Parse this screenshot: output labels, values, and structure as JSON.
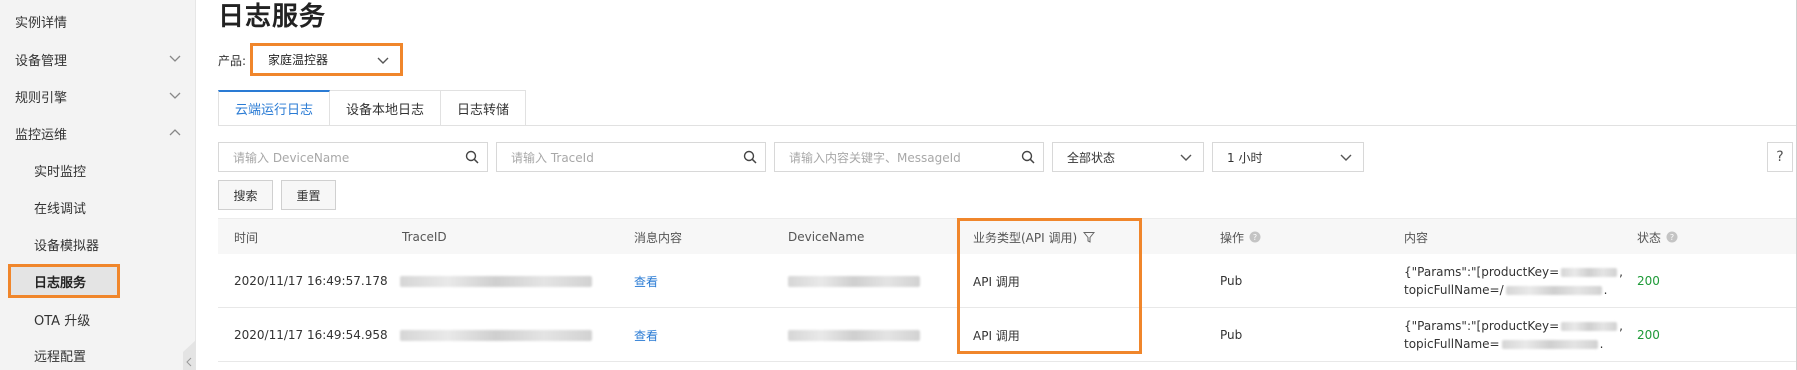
{
  "sidebar": {
    "items": [
      {
        "label": "实例详情",
        "level": 1,
        "chevron": "none"
      },
      {
        "label": "设备管理",
        "level": 1,
        "chevron": "down"
      },
      {
        "label": "规则引擎",
        "level": 1,
        "chevron": "down"
      },
      {
        "label": "监控运维",
        "level": 1,
        "chevron": "up"
      },
      {
        "label": "实时监控",
        "level": 2
      },
      {
        "label": "在线调试",
        "level": 2
      },
      {
        "label": "设备模拟器",
        "level": 2
      },
      {
        "label": "日志服务",
        "level": 2,
        "active": true
      },
      {
        "label": "OTA 升级",
        "level": 2
      },
      {
        "label": "远程配置",
        "level": 2
      }
    ]
  },
  "page": {
    "title": "日志服务",
    "product_label": "产品:",
    "product_value": "家庭温控器"
  },
  "tabs": [
    {
      "label": "云端运行日志",
      "active": true
    },
    {
      "label": "设备本地日志"
    },
    {
      "label": "日志转储"
    }
  ],
  "filters": {
    "device_name_placeholder": "请输入 DeviceName",
    "trace_id_placeholder": "请输入 TraceId",
    "content_placeholder": "请输入内容关键字、MessageId",
    "status_value": "全部状态",
    "time_value": "1 小时",
    "help_label": "?"
  },
  "buttons": {
    "search": "搜索",
    "reset": "重置"
  },
  "table": {
    "headers": {
      "time": "时间",
      "trace_id": "TraceID",
      "message": "消息内容",
      "device_name": "DeviceName",
      "biz_type": "业务类型(API 调用)",
      "operation": "操作",
      "content": "内容",
      "status": "状态"
    },
    "rows": [
      {
        "time": "2020/11/17 16:49:57.178",
        "message": "查看",
        "biz_type": "API 调用",
        "operation": "Pub",
        "content_line1_prefix": "{\"Params\":\"[productKey=",
        "content_line1_suffix": ",",
        "content_line2_prefix": "topicFullName=/",
        "content_line2_suffix": ".",
        "status": "200"
      },
      {
        "time": "2020/11/17 16:49:54.958",
        "message": "查看",
        "biz_type": "API 调用",
        "operation": "Pub",
        "content_line1_prefix": "{\"Params\":\"[productKey=",
        "content_line1_suffix": ",",
        "content_line2_prefix": "topicFullName=",
        "content_line2_suffix": ".",
        "status": "200"
      }
    ]
  },
  "colors": {
    "accent": "#2a7bd4",
    "highlight": "#f0862b",
    "status_ok": "#1e9a38"
  }
}
